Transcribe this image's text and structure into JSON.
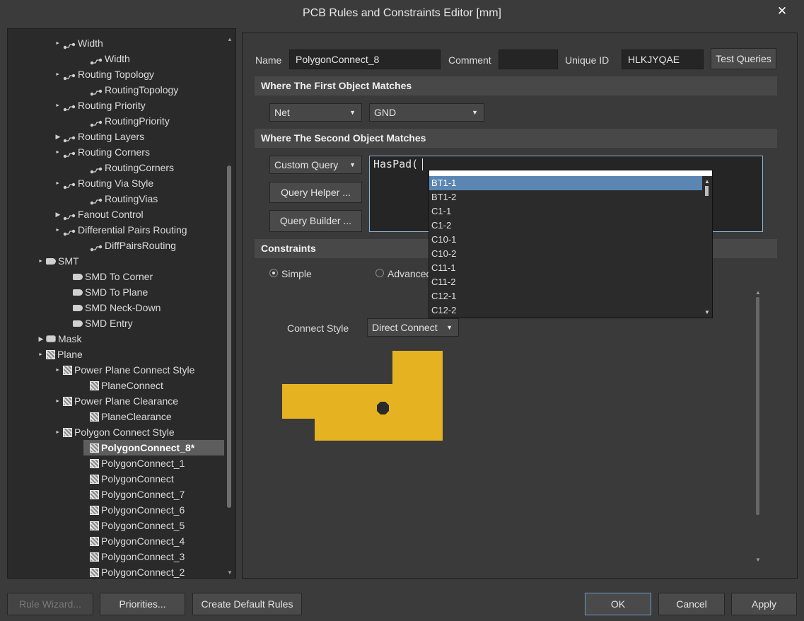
{
  "window": {
    "title": "PCB Rules and Constraints Editor [mm]",
    "close_glyph": "✕"
  },
  "tree": {
    "items": [
      {
        "label": "Width",
        "icon": "routing-icon",
        "expander": "▲"
      },
      {
        "label": "Width",
        "icon": "routing-icon",
        "expander": ""
      },
      {
        "label": "Routing Topology",
        "icon": "routing-icon",
        "expander": "▲"
      },
      {
        "label": "RoutingTopology",
        "icon": "routing-icon",
        "expander": ""
      },
      {
        "label": "Routing Priority",
        "icon": "routing-icon",
        "expander": "▲"
      },
      {
        "label": "RoutingPriority",
        "icon": "routing-icon",
        "expander": ""
      },
      {
        "label": "Routing Layers",
        "icon": "routing-icon",
        "expander": "▶"
      },
      {
        "label": "Routing Corners",
        "icon": "routing-icon",
        "expander": "▲"
      },
      {
        "label": "RoutingCorners",
        "icon": "routing-icon",
        "expander": ""
      },
      {
        "label": "Routing Via Style",
        "icon": "routing-icon",
        "expander": "▲"
      },
      {
        "label": "RoutingVias",
        "icon": "routing-icon",
        "expander": ""
      },
      {
        "label": "Fanout Control",
        "icon": "routing-icon",
        "expander": "▶"
      },
      {
        "label": "Differential Pairs Routing",
        "icon": "routing-icon",
        "expander": "▲"
      },
      {
        "label": "DiffPairsRouting",
        "icon": "routing-icon",
        "expander": ""
      },
      {
        "label": "SMT",
        "icon": "smt-icon",
        "expander": "▲"
      },
      {
        "label": "SMD To Corner",
        "icon": "smt-icon",
        "expander": ""
      },
      {
        "label": "SMD To Plane",
        "icon": "smt-icon",
        "expander": ""
      },
      {
        "label": "SMD Neck-Down",
        "icon": "smt-icon",
        "expander": ""
      },
      {
        "label": "SMD Entry",
        "icon": "smt-icon",
        "expander": ""
      },
      {
        "label": "Mask",
        "icon": "mask-icon",
        "expander": "▶"
      },
      {
        "label": "Plane",
        "icon": "plane-icon",
        "expander": "▲"
      },
      {
        "label": "Power Plane Connect Style",
        "icon": "plane-icon",
        "expander": "▲"
      },
      {
        "label": "PlaneConnect",
        "icon": "plane-icon",
        "expander": ""
      },
      {
        "label": "Power Plane Clearance",
        "icon": "plane-icon",
        "expander": "▲"
      },
      {
        "label": "PlaneClearance",
        "icon": "plane-icon",
        "expander": ""
      },
      {
        "label": "Polygon Connect Style",
        "icon": "plane-icon",
        "expander": "▲"
      },
      {
        "label": "PolygonConnect_8*",
        "icon": "plane-icon",
        "expander": "",
        "selected": true
      },
      {
        "label": "PolygonConnect_1",
        "icon": "plane-icon",
        "expander": ""
      },
      {
        "label": "PolygonConnect",
        "icon": "plane-icon",
        "expander": ""
      },
      {
        "label": "PolygonConnect_7",
        "icon": "plane-icon",
        "expander": ""
      },
      {
        "label": "PolygonConnect_6",
        "icon": "plane-icon",
        "expander": ""
      },
      {
        "label": "PolygonConnect_5",
        "icon": "plane-icon",
        "expander": ""
      },
      {
        "label": "PolygonConnect_4",
        "icon": "plane-icon",
        "expander": ""
      },
      {
        "label": "PolygonConnect_3",
        "icon": "plane-icon",
        "expander": ""
      },
      {
        "label": "PolygonConnect_2",
        "icon": "plane-icon",
        "expander": ""
      }
    ]
  },
  "rule": {
    "name_label": "Name",
    "name_value": "PolygonConnect_8",
    "comment_label": "Comment",
    "comment_value": "",
    "uid_label": "Unique ID",
    "uid_value": "HLKJYQAE",
    "test_queries": "Test Queries"
  },
  "first_match": {
    "header": "Where The First Object Matches",
    "type": "Net",
    "value": "GND"
  },
  "second_match": {
    "header": "Where The Second Object Matches",
    "type": "Custom Query",
    "query_helper": "Query Helper ...",
    "query_builder": "Query Builder ...",
    "query_text": "HasPad(",
    "autocomplete": [
      "BT1-1",
      "BT1-2",
      "C1-1",
      "C1-2",
      "C10-1",
      "C10-2",
      "C11-1",
      "C11-2",
      "C12-1",
      "C12-2"
    ],
    "highlighted": "BT1-1"
  },
  "constraints": {
    "header": "Constraints",
    "simple": "Simple",
    "advanced": "Advanced",
    "selected_mode": "Simple",
    "connect_style_label": "Connect Style",
    "connect_style_value": "Direct Connect",
    "preview_color": "#e5b322"
  },
  "footer": {
    "rule_wizard": "Rule Wizard...",
    "priorities": "Priorities...",
    "create_default": "Create Default Rules",
    "ok": "OK",
    "cancel": "Cancel",
    "apply": "Apply"
  }
}
